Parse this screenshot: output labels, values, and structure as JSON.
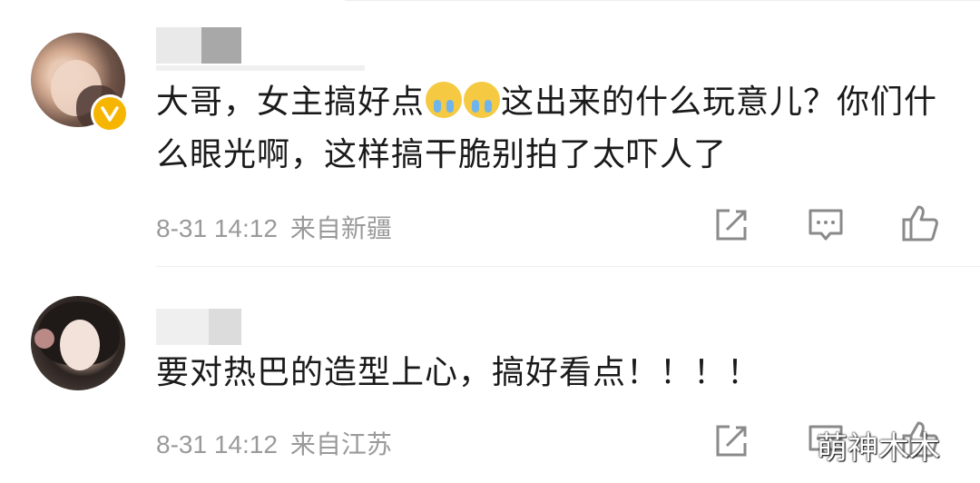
{
  "comments": [
    {
      "text_part1": "大哥，女主搞好点",
      "emoji_name": "crying-face-emoji",
      "text_part2": "这出来的什么玩意儿？你们什么眼光啊，这样搞干脆别拍了太吓人了",
      "time": "8-31 14:12",
      "location": "来自新疆",
      "verified": true
    },
    {
      "text": "要对热巴的造型上心，搞好看点！！！！",
      "time": "8-31 14:12",
      "location": "来自江苏"
    }
  ],
  "watermark": "萌神木木",
  "colors": {
    "badge": "#f5b500",
    "meta": "#9a9a9a",
    "text": "#1a1a1a"
  },
  "icons": [
    "share-icon",
    "comment-icon",
    "like-icon"
  ]
}
